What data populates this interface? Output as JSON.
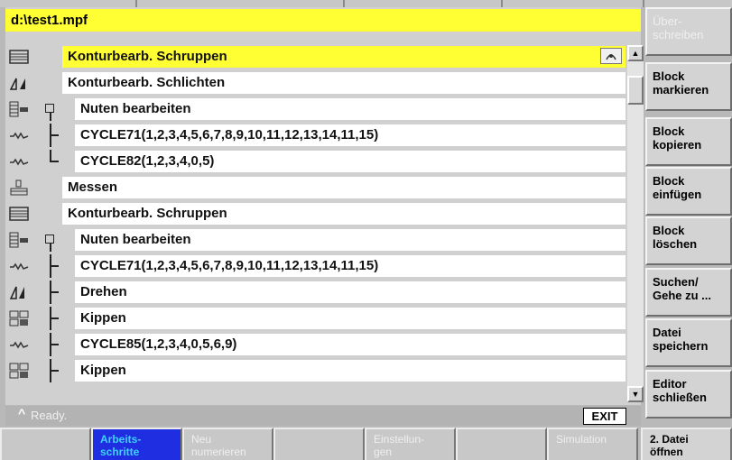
{
  "file_title": "d:\\test1.mpf",
  "rows": [
    {
      "icon": "roughing-icon",
      "tree": "",
      "text": "Konturbearb. Schruppen",
      "selected": true
    },
    {
      "icon": "finishing-icon",
      "tree": "",
      "text": "Konturbearb. Schlichten"
    },
    {
      "icon": "grooving-icon",
      "tree": "branch-top",
      "text": "Nuten bearbeiten"
    },
    {
      "icon": "cycle-icon",
      "tree": "tee",
      "text": "CYCLE71(1,2,3,4,5,6,7,8,9,10,11,12,13,14,11,15)"
    },
    {
      "icon": "cycle-icon",
      "tree": "end",
      "text": "CYCLE82(1,2,3,4,0,5)"
    },
    {
      "icon": "measure-icon",
      "tree": "",
      "text": "Messen"
    },
    {
      "icon": "roughing-icon",
      "tree": "",
      "text": "Konturbearb. Schruppen"
    },
    {
      "icon": "grooving-icon",
      "tree": "branch-top",
      "text": "Nuten bearbeiten"
    },
    {
      "icon": "cycle-icon",
      "tree": "tee",
      "text": "CYCLE71(1,2,3,4,5,6,7,8,9,10,11,12,13,14,11,15)"
    },
    {
      "icon": "turning-icon",
      "tree": "tee",
      "text": "Drehen"
    },
    {
      "icon": "tilt-icon",
      "tree": "tee",
      "text": "Kippen"
    },
    {
      "icon": "cycle-icon",
      "tree": "tee",
      "text": "CYCLE85(1,2,3,4,0,5,6,9)"
    },
    {
      "icon": "tilt-icon",
      "tree": "tee",
      "text": "Kippen"
    }
  ],
  "status": {
    "caret": "^",
    "text": "Ready.",
    "exit_label": "EXIT"
  },
  "vertical_softkeys": [
    {
      "label1": "Über-",
      "label2": "schreiben",
      "enabled": false
    },
    {
      "label1": "Block",
      "label2": "markieren",
      "enabled": true
    },
    {
      "label1": "Block",
      "label2": "kopieren",
      "enabled": true
    },
    {
      "label1": "Block",
      "label2": "einfügen",
      "enabled": true
    },
    {
      "label1": "Block",
      "label2": "löschen",
      "enabled": true
    },
    {
      "label1": "Suchen/",
      "label2": "Gehe zu ...",
      "enabled": true
    },
    {
      "label1": "Datei",
      "label2": "speichern",
      "enabled": true
    },
    {
      "label1": "Editor",
      "label2": "schließen",
      "enabled": true
    }
  ],
  "horizontal_softkeys": [
    {
      "label1": "",
      "label2": "",
      "state": "disabled"
    },
    {
      "label1": "Arbeits-",
      "label2": "schritte",
      "state": "active"
    },
    {
      "label1": "Neu",
      "label2": "numerieren",
      "state": "disabled"
    },
    {
      "label1": "",
      "label2": "",
      "state": "disabled"
    },
    {
      "label1": "Einstellun-",
      "label2": "gen",
      "state": "disabled"
    },
    {
      "label1": "",
      "label2": "",
      "state": "disabled"
    },
    {
      "label1": "Simulation",
      "label2": "",
      "state": "disabled"
    },
    {
      "label1": "2. Datei",
      "label2": "öffnen",
      "state": "enabled"
    }
  ],
  "colors": {
    "selection": "#ffff33",
    "active_softkey": "#1f2ee0",
    "background": "#b9b9b9"
  }
}
